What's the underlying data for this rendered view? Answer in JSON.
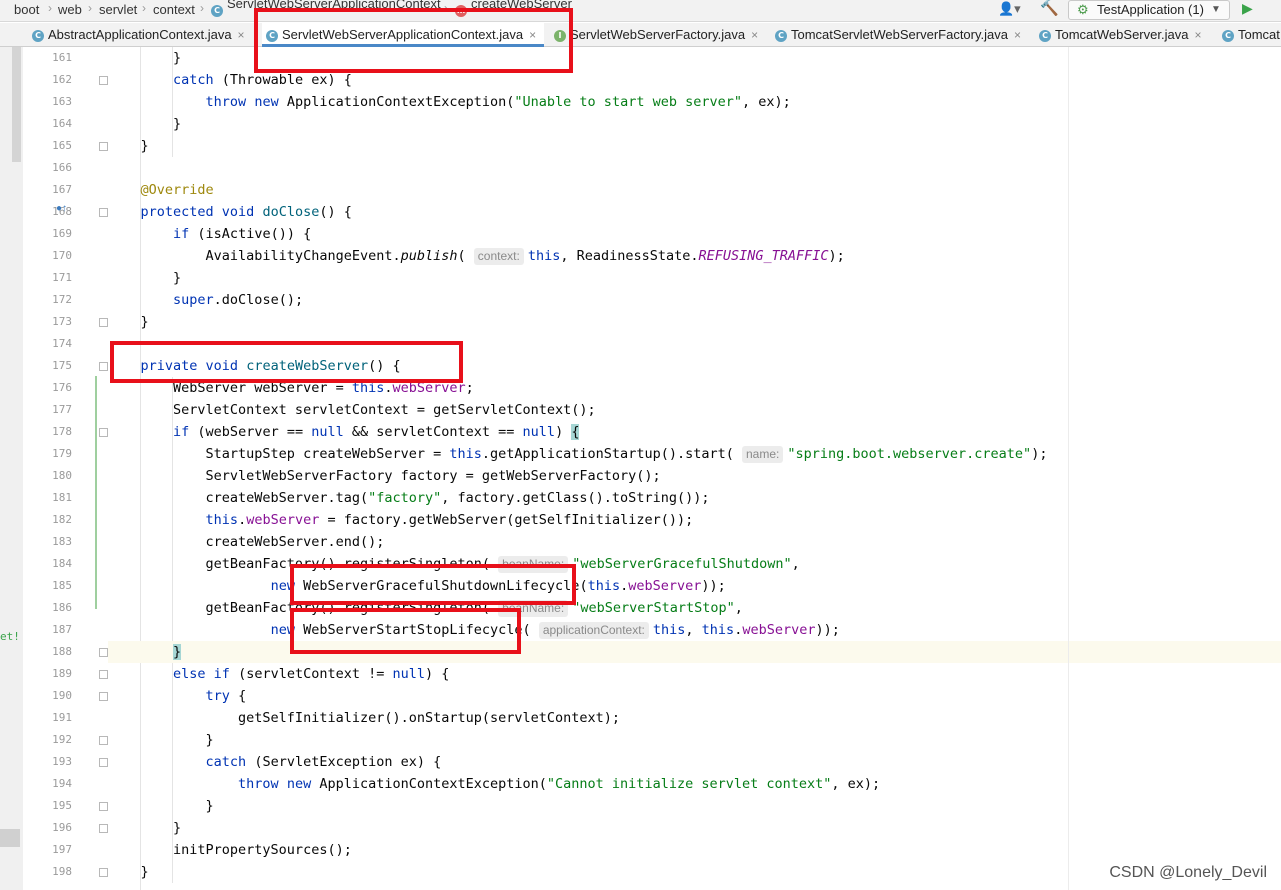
{
  "breadcrumb": {
    "items": [
      "boot",
      "web",
      "servlet",
      "context",
      "ServletWebServerApplicationContext",
      "createWebServer"
    ]
  },
  "run_config": {
    "label": "TestApplication (1)"
  },
  "tabs": [
    {
      "label": "AbstractApplicationContext.java",
      "icon": "class-icon"
    },
    {
      "label": "ServletWebServerApplicationContext.java",
      "icon": "class-icon",
      "active": true
    },
    {
      "label": "ServletWebServerFactory.java",
      "icon": "interface-icon"
    },
    {
      "label": "TomcatServletWebServerFactory.java",
      "icon": "class-icon"
    },
    {
      "label": "TomcatWebServer.java",
      "icon": "class-icon"
    },
    {
      "label": "Tomcat",
      "icon": "class-icon"
    }
  ],
  "line_numbers": [
    "161",
    "162",
    "163",
    "164",
    "165",
    "166",
    "167",
    "168",
    "169",
    "170",
    "171",
    "172",
    "173",
    "174",
    "175",
    "176",
    "177",
    "178",
    "179",
    "180",
    "181",
    "182",
    "183",
    "184",
    "185",
    "186",
    "187",
    "188",
    "189",
    "190",
    "191",
    "192",
    "193",
    "194",
    "195",
    "196",
    "197",
    "198"
  ],
  "code": {
    "l163_msg": "\"Unable to start web server\"",
    "l167": "@Override",
    "l170_hint": "context:",
    "l170_const": "REFUSING_TRAFFIC",
    "l175_method": "createWebServer",
    "l179_hint": "name:",
    "l179_str": "\"spring.boot.webserver.create\"",
    "l181_str": "\"factory\"",
    "l184_hint": "beanName:",
    "l184_str": "\"webServerGracefulShutdown\"",
    "l185_class": "WebServerGracefulShutdownLifecycle",
    "l186_hint": "beanName:",
    "l186_str": "\"webServerStartStop\"",
    "l187_class": "WebServerStartStopLifecycle",
    "l187_hint": "applicationContext:",
    "l194_msg": "\"Cannot initialize servlet context\""
  },
  "watermark": "CSDN @Lonely_Devil",
  "side_fragment": "et!",
  "colors": {
    "highlight_box": "#e8101a",
    "active_tab_underline": "#4a88c7"
  }
}
